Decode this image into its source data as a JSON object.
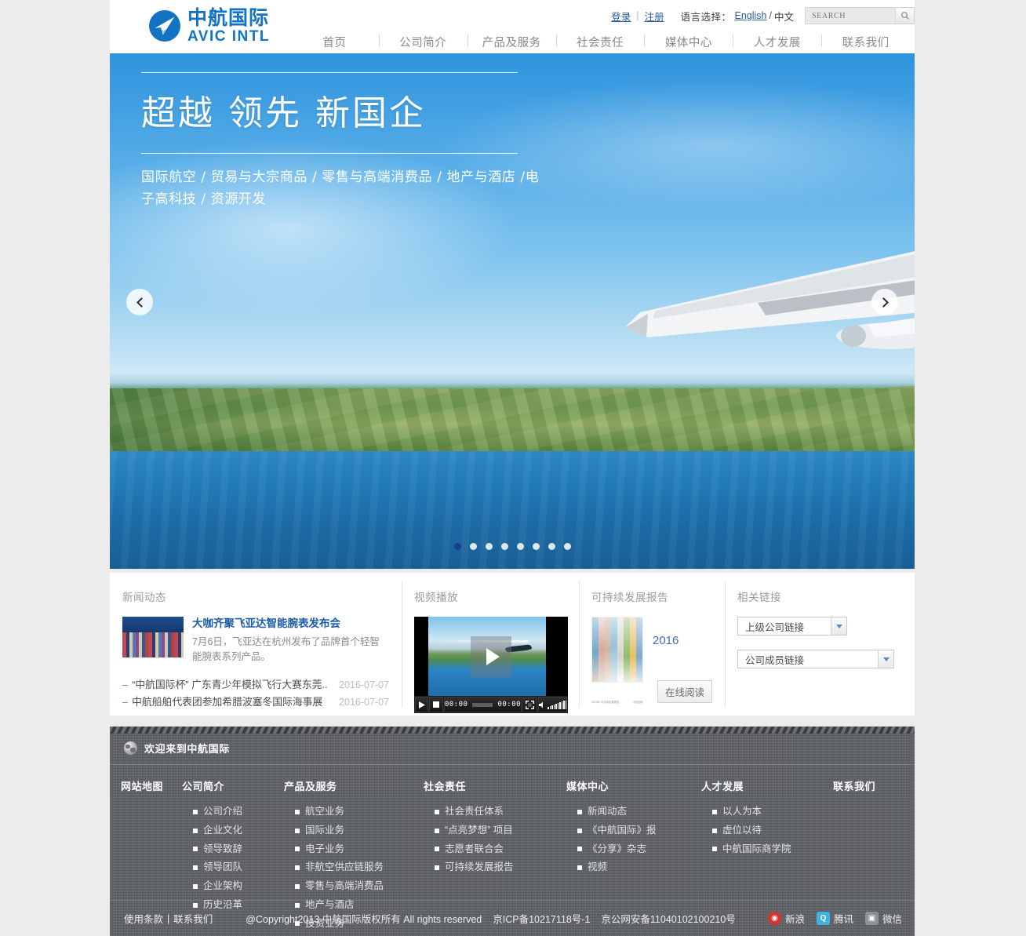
{
  "header": {
    "logo": {
      "cn": "中航国际",
      "en": "AVIC  INTL",
      "mark_label": "AVIC"
    },
    "topbar": {
      "login": "登录",
      "separator": "|",
      "register": "注册",
      "language_label": "语言选择：",
      "lang_en": "English",
      "lang_slash": "/",
      "lang_cn": "中文",
      "search_placeholder": "SEARCH",
      "search_value": ""
    },
    "nav": [
      {
        "label": "首页"
      },
      {
        "label": "公司简介"
      },
      {
        "label": "产品及服务"
      },
      {
        "label": "社会责任"
      },
      {
        "label": "媒体中心"
      },
      {
        "label": "人才发展"
      },
      {
        "label": "联系我们"
      }
    ]
  },
  "hero": {
    "title": "超越 领先 新国企",
    "subtitle": "国际航空 / 贸易与大宗商品 / 零售与高端消费品 / 地产与酒店 /电子高科技 / 资源开发",
    "prev_label": "‹",
    "next_label": "›",
    "slide_count": 8,
    "active_slide": 1
  },
  "panels": {
    "news": {
      "title": "新闻动态",
      "feature": {
        "headline": "大咖齐聚飞亚达智能腕表发布会",
        "summary": "7月6日，飞亚达在杭州发布了品牌首个轻智能腕表系列产品。"
      },
      "items": [
        {
          "dash": "–",
          "title": "“中航国际杯” 广东青少年模拟飞行大赛东莞..",
          "date": "2016-07-07"
        },
        {
          "dash": "–",
          "title": "中航船舶代表团参加希腊波塞冬国际海事展",
          "date": "2016-07-07"
        }
      ]
    },
    "video": {
      "title": "视频播放",
      "play_label": "播放",
      "controls": {
        "play": "▶",
        "stop": "■",
        "current_time": "00:00",
        "total_time": "00:00",
        "fullscreen": "⛶",
        "volume": "🔊"
      }
    },
    "report": {
      "title": "可持续发展报告",
      "year": "2016",
      "read_button": "在线阅读",
      "cover_caption_left": "2016年\n可持续发展报告",
      "cover_caption_right": "中航国际"
    },
    "links": {
      "title": "相关链接",
      "selects": [
        {
          "value": "上级公司链接"
        },
        {
          "value": "公司成员链接"
        }
      ]
    }
  },
  "footer": {
    "welcome": "欢迎来到中航国际",
    "sitemap_label": "网站地图",
    "columns": [
      {
        "head": "公司简介",
        "items": [
          "公司介绍",
          "企业文化",
          "领导致辞",
          "领导团队",
          "企业架构",
          "历史沿革"
        ]
      },
      {
        "head": "产品及服务",
        "items": [
          "航空业务",
          "国际业务",
          "电子业务",
          "非航空供应链服务",
          "零售与高端消费品",
          "地产与酒店",
          "投资业务"
        ]
      },
      {
        "head": "社会责任",
        "items": [
          "社会责任体系",
          "“点亮梦想” 项目",
          "志愿者联合会",
          "可持续发展报告"
        ]
      },
      {
        "head": "媒体中心",
        "items": [
          "新闻动态",
          "《中航国际》报",
          "《分享》杂志",
          "视频"
        ]
      },
      {
        "head": "人才发展",
        "items": [
          "以人为本",
          "虚位以待",
          "中航国际商学院"
        ]
      },
      {
        "head": "联系我们",
        "items": []
      }
    ],
    "bottom": {
      "terms": "使用条款",
      "divider": "|",
      "contact": "联系我们",
      "copyright": "@Copyright2013 中航国际版权所有 All rights reserved",
      "icp": "京ICP备10217118号-1",
      "police": "京公网安备11040102100210号",
      "social": [
        {
          "name": "新浪",
          "icon": "weibo-icon",
          "color": "#d8322a"
        },
        {
          "name": "腾讯",
          "icon": "qq-icon",
          "color": "#3fb3e0"
        },
        {
          "name": "微信",
          "icon": "wechat-icon",
          "color": "#8e9196"
        }
      ]
    }
  },
  "colors": {
    "brand_blue": "#1273c4",
    "link_blue": "#2b5c9b",
    "footer_gray": "#5d6066",
    "page_bg": "#ececec"
  }
}
